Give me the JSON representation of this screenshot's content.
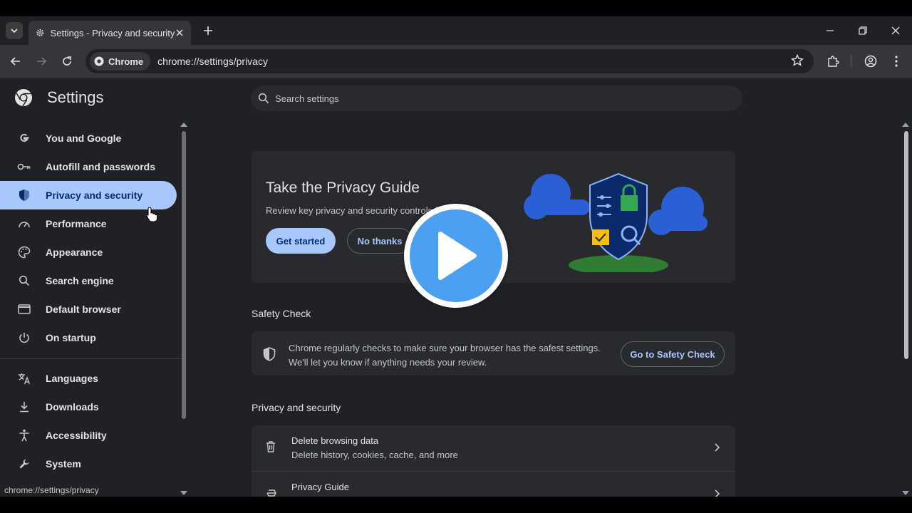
{
  "tab": {
    "title": "Settings - Privacy and security"
  },
  "omnibox": {
    "chip_label": "Chrome",
    "url": "chrome://settings/privacy"
  },
  "settings": {
    "app_title": "Settings",
    "search_placeholder": "Search settings",
    "nav": [
      {
        "label": "You and Google",
        "icon": "google-g-icon"
      },
      {
        "label": "Autofill and passwords",
        "icon": "key-icon"
      },
      {
        "label": "Privacy and security",
        "icon": "shield-icon",
        "active": true
      },
      {
        "label": "Performance",
        "icon": "speedometer-icon"
      },
      {
        "label": "Appearance",
        "icon": "palette-icon"
      },
      {
        "label": "Search engine",
        "icon": "search-icon"
      },
      {
        "label": "Default browser",
        "icon": "browser-window-icon"
      },
      {
        "label": "On startup",
        "icon": "power-icon"
      },
      {
        "label": "Languages",
        "icon": "translate-icon"
      },
      {
        "label": "Downloads",
        "icon": "download-icon"
      },
      {
        "label": "Accessibility",
        "icon": "accessibility-icon"
      },
      {
        "label": "System",
        "icon": "wrench-icon"
      }
    ]
  },
  "privacy_guide": {
    "title": "Take the Privacy Guide",
    "description": "Review key privacy and security controls in",
    "get_started": "Get started",
    "no_thanks": "No thanks"
  },
  "safety_check": {
    "section_title": "Safety Check",
    "line1": "Chrome regularly checks to make sure your browser has the safest settings.",
    "line2": "We'll let you know if anything needs your review.",
    "button": "Go to Safety Check"
  },
  "privacy_section": {
    "section_title": "Privacy and security",
    "rows": [
      {
        "title": "Delete browsing data",
        "subtitle": "Delete history, cookies, cache, and more"
      },
      {
        "title": "Privacy Guide",
        "subtitle": ""
      }
    ]
  },
  "status_bar": {
    "url": "chrome://settings/privacy"
  },
  "colors": {
    "accent": "#a8c7fa",
    "play_button": "#4a9ff0",
    "page_bg": "#202124"
  }
}
